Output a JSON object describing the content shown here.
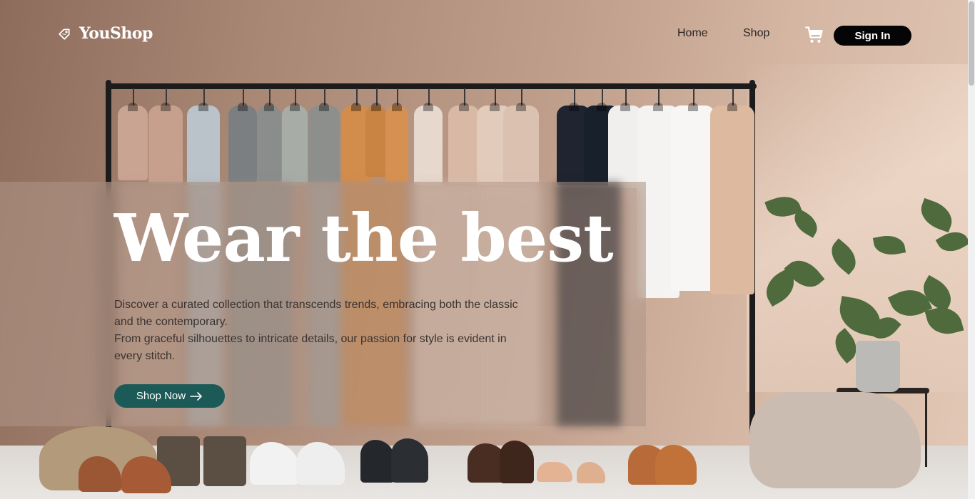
{
  "window": {
    "title": "YouShop"
  },
  "brand": {
    "name": "YouShop",
    "icon": "tag-icon"
  },
  "nav": {
    "links": [
      {
        "label": "Home"
      },
      {
        "label": "Shop"
      }
    ],
    "cart_icon": "cart-icon",
    "signin_label": "Sign In"
  },
  "hero": {
    "title": "Wear the best",
    "description": [
      "Discover a curated collection that transcends trends, embracing both the classic and the contemporary.",
      "From graceful silhouettes to intricate details, our passion for style is evident in every stitch."
    ],
    "cta_label": "Shop Now",
    "cta_icon": "arrow-right-icon"
  },
  "colors": {
    "accent": "#1b5a57",
    "signin_bg": "#050505",
    "title_text": "#ffffff"
  }
}
